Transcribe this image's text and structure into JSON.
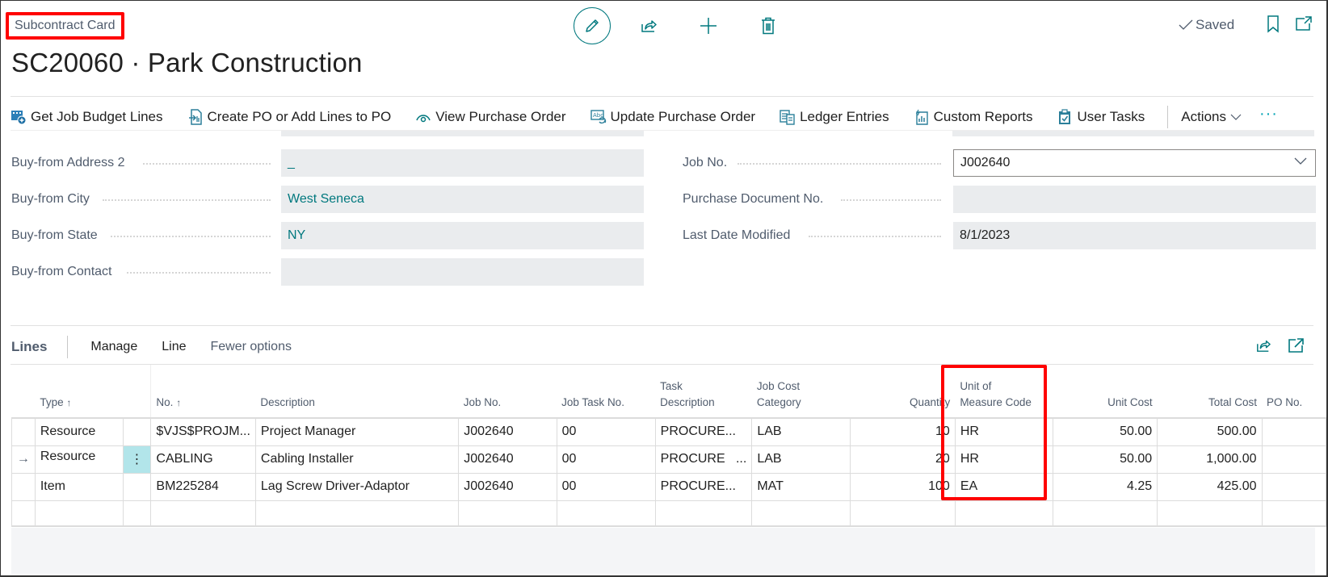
{
  "header": {
    "caption": "Subcontract Card",
    "title": "SC20060 · Park Construction",
    "status": "Saved",
    "icons": {
      "edit": "pencil-icon",
      "share": "share-icon",
      "new": "plus-icon",
      "delete": "trash-icon",
      "saved": "checkmark-icon",
      "bookmark": "bookmark-icon",
      "popout": "open-in-new-window-icon"
    }
  },
  "action_bar": {
    "items": [
      {
        "label": "Get Job Budget Lines",
        "icon": "budget-lines-icon"
      },
      {
        "label": "Create PO or Add Lines to PO",
        "icon": "create-po-icon"
      },
      {
        "label": "View Purchase Order",
        "icon": "view-icon"
      },
      {
        "label": "Update Purchase Order",
        "icon": "update-icon"
      },
      {
        "label": "Ledger Entries",
        "icon": "ledger-icon"
      },
      {
        "label": "Custom Reports",
        "icon": "report-icon"
      },
      {
        "label": "User Tasks",
        "icon": "clipboard-check-icon"
      }
    ],
    "actions_label": "Actions",
    "more_label": "···"
  },
  "fields_left": [
    {
      "label": "Buy-from Address 2",
      "value": "_",
      "link": true
    },
    {
      "label": "Buy-from City",
      "value": "West Seneca",
      "link": true
    },
    {
      "label": "Buy-from State",
      "value": "NY",
      "link": true
    },
    {
      "label": "Buy-from Contact",
      "value": "",
      "link": false
    }
  ],
  "fields_right": [
    {
      "label": "Job No.",
      "value": "J002640",
      "editable": true
    },
    {
      "label": "Purchase Document No.",
      "value": ""
    },
    {
      "label": "Last Date Modified",
      "value": "8/1/2023"
    }
  ],
  "lines": {
    "title": "Lines",
    "menu": [
      "Manage",
      "Line",
      "Fewer options"
    ],
    "columns": {
      "type": "Type",
      "no": "No.",
      "description": "Description",
      "job_no": "Job No.",
      "job_task_no": "Job Task No.",
      "task_description_1": "Task",
      "task_description_2": "Description",
      "job_cost_category_1": "Job Cost",
      "job_cost_category_2": "Category",
      "quantity": "Quantity",
      "uom_1": "Unit of",
      "uom_2": "Measure Code",
      "unit_cost": "Unit Cost",
      "total_cost": "Total Cost",
      "po_no": "PO No."
    },
    "sort_arrow": "↑",
    "current_row_marker": "→",
    "row_menu": "⋮",
    "rows": [
      {
        "type": "Resource",
        "no": "$VJS$PROJM...",
        "description": "Project Manager",
        "job_no": "J002640",
        "job_task_no": "00",
        "task_description": "PROCURE...",
        "job_cost_category": "LAB",
        "quantity": "10",
        "uom": "HR",
        "unit_cost": "50.00",
        "total_cost": "500.00",
        "po_no": ""
      },
      {
        "type": "Resource",
        "no": "CABLING",
        "description": "Cabling Installer",
        "job_no": "J002640",
        "job_task_no": "00",
        "task_description": "PROCURE   ...",
        "job_cost_category": "LAB",
        "quantity": "20",
        "uom": "HR",
        "unit_cost": "50.00",
        "total_cost": "1,000.00",
        "po_no": ""
      },
      {
        "type": "Item",
        "no": "BM225284",
        "description": "Lag Screw Driver-Adaptor",
        "job_no": "J002640",
        "job_task_no": "00",
        "task_description": "PROCURE...",
        "job_cost_category": "MAT",
        "quantity": "100",
        "uom": "EA",
        "unit_cost": "4.25",
        "total_cost": "425.00",
        "po_no": ""
      }
    ]
  },
  "colors": {
    "accent": "#00787e",
    "highlight_box": "#ff0000",
    "selected_cell": "#b2e5ea",
    "readonly_field": "#eaecee"
  }
}
